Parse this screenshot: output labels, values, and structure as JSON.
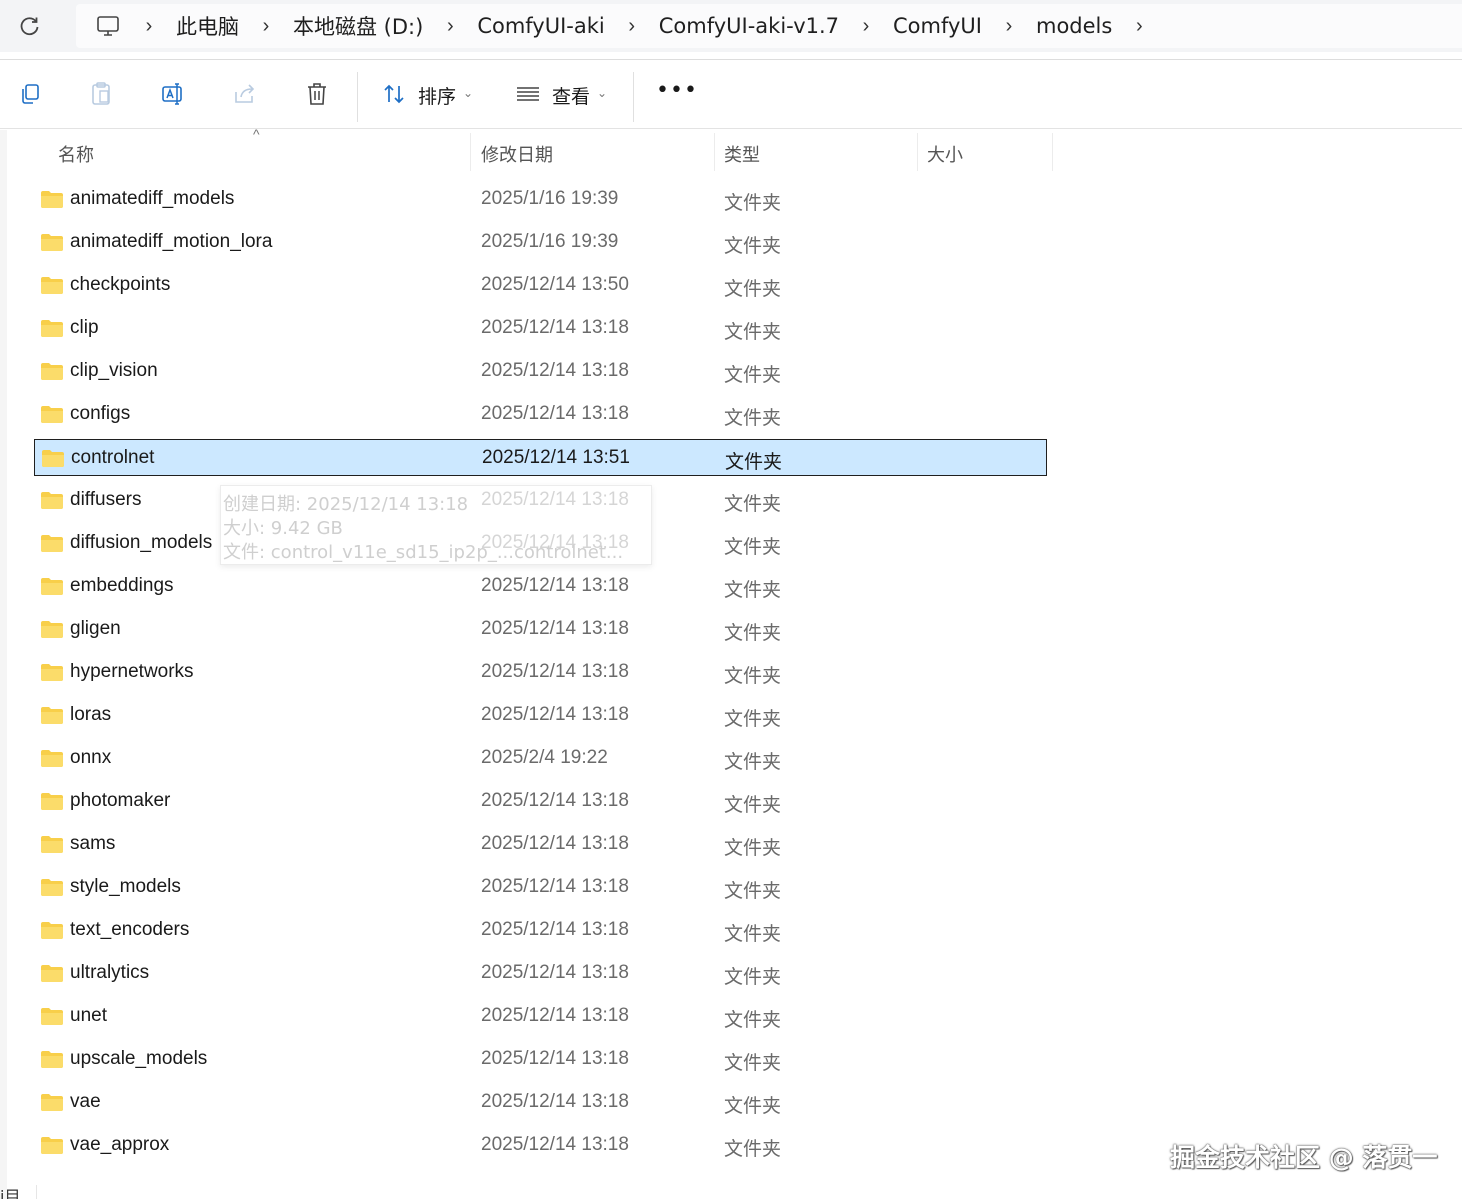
{
  "breadcrumb": {
    "items": [
      "此电脑",
      "本地磁盘 (D:)",
      "ComfyUI-aki",
      "ComfyUI-aki-v1.7",
      "ComfyUI",
      "models"
    ],
    "root_icon": "computer-icon"
  },
  "toolbar": {
    "sort_label": "排序",
    "view_label": "查看",
    "more_label": "•••"
  },
  "columns": {
    "name": "名称",
    "modified": "修改日期",
    "type": "类型",
    "size": "大小"
  },
  "files": [
    {
      "name": "animatediff_models",
      "modified": "2025/1/16 19:39",
      "type": "文件夹"
    },
    {
      "name": "animatediff_motion_lora",
      "modified": "2025/1/16 19:39",
      "type": "文件夹"
    },
    {
      "name": "checkpoints",
      "modified": "2025/12/14 13:50",
      "type": "文件夹"
    },
    {
      "name": "clip",
      "modified": "2025/12/14 13:18",
      "type": "文件夹"
    },
    {
      "name": "clip_vision",
      "modified": "2025/12/14 13:18",
      "type": "文件夹"
    },
    {
      "name": "configs",
      "modified": "2025/12/14 13:18",
      "type": "文件夹"
    },
    {
      "name": "controlnet",
      "modified": "2025/12/14 13:51",
      "type": "文件夹",
      "selected": true
    },
    {
      "name": "diffusers",
      "modified": "2025/12/14 13:18",
      "type": "文件夹"
    },
    {
      "name": "diffusion_models",
      "modified": "2025/12/14 13:18",
      "type": "文件夹"
    },
    {
      "name": "embeddings",
      "modified": "2025/12/14 13:18",
      "type": "文件夹"
    },
    {
      "name": "gligen",
      "modified": "2025/12/14 13:18",
      "type": "文件夹"
    },
    {
      "name": "hypernetworks",
      "modified": "2025/12/14 13:18",
      "type": "文件夹"
    },
    {
      "name": "loras",
      "modified": "2025/12/14 13:18",
      "type": "文件夹"
    },
    {
      "name": "onnx",
      "modified": "2025/2/4 19:22",
      "type": "文件夹"
    },
    {
      "name": "photomaker",
      "modified": "2025/12/14 13:18",
      "type": "文件夹"
    },
    {
      "name": "sams",
      "modified": "2025/12/14 13:18",
      "type": "文件夹"
    },
    {
      "name": "style_models",
      "modified": "2025/12/14 13:18",
      "type": "文件夹"
    },
    {
      "name": "text_encoders",
      "modified": "2025/12/14 13:18",
      "type": "文件夹"
    },
    {
      "name": "ultralytics",
      "modified": "2025/12/14 13:18",
      "type": "文件夹"
    },
    {
      "name": "unet",
      "modified": "2025/12/14 13:18",
      "type": "文件夹"
    },
    {
      "name": "upscale_models",
      "modified": "2025/12/14 13:18",
      "type": "文件夹"
    },
    {
      "name": "vae",
      "modified": "2025/12/14 13:18",
      "type": "文件夹"
    },
    {
      "name": "vae_approx",
      "modified": "2025/12/14 13:18",
      "type": "文件夹"
    }
  ],
  "tooltip": {
    "created": "创建日期: 2025/12/14 13:18",
    "size": "大小: 9.42 GB",
    "files": "文件: control_v11e_sd15_ip2p_...controlnet..."
  },
  "status": {
    "stub": "i目"
  },
  "watermark": "掘金技术社区 @ 落贯一",
  "colors": {
    "selection_bg": "#cce8ff",
    "folder_yellow": "#f8cf4a"
  }
}
